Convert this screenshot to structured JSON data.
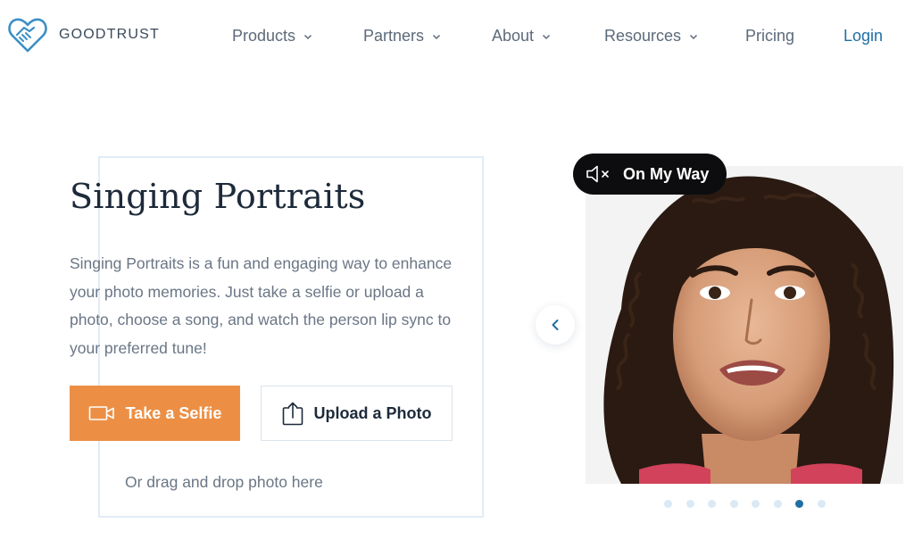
{
  "brand": {
    "name": "GOODTRUST"
  },
  "nav": {
    "items": [
      {
        "label": "Products",
        "has_dropdown": true
      },
      {
        "label": "Partners",
        "has_dropdown": true
      },
      {
        "label": "About",
        "has_dropdown": true
      },
      {
        "label": "Resources",
        "has_dropdown": true
      },
      {
        "label": "Pricing",
        "has_dropdown": false
      }
    ],
    "login_label": "Login"
  },
  "hero": {
    "title": "Singing Portraits",
    "description": "Singing Portraits is a fun and engaging way to enhance your photo memories. Just take a selfie or upload a photo, choose a song, and watch the person lip sync to your preferred tune!",
    "selfie_button": "Take a Selfie",
    "upload_button": "Upload a Photo",
    "drag_hint": "Or drag and drop photo here"
  },
  "carousel": {
    "song_label": "On My Way",
    "sound_icon": "speaker-muted-icon",
    "dot_count": 8,
    "active_dot_index": 6
  },
  "colors": {
    "accent_orange": "#ec8f45",
    "link_blue": "#1f6fa3",
    "text_dark": "#1d2a3a",
    "text_muted": "#6a7685",
    "nav_text": "#5c6a79",
    "dot_inactive": "#dbe9f4",
    "pill_bg": "#0d0d0f"
  }
}
